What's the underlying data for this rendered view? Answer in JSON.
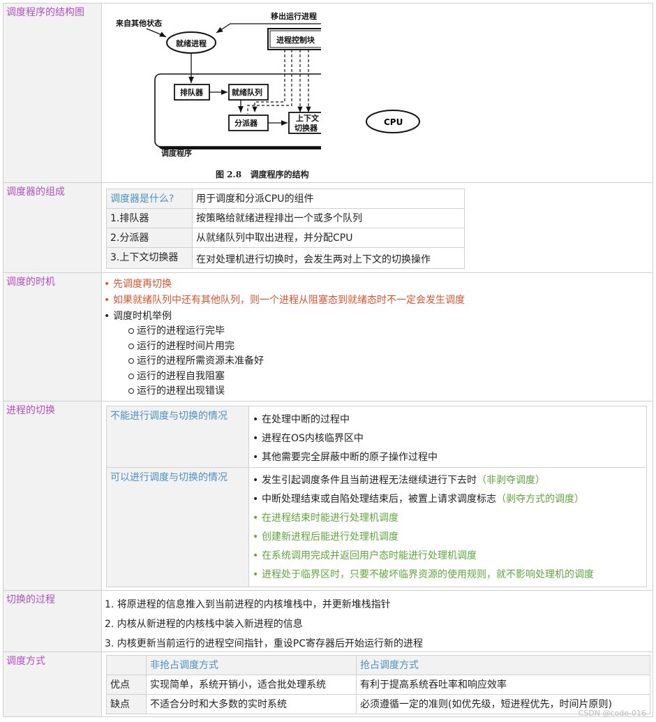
{
  "rows": {
    "r1": {
      "label": "调度程序的结构图"
    },
    "r2": {
      "label": "调度器的组成"
    },
    "r3": {
      "label": "调度的时机"
    },
    "r4": {
      "label": "进程的切换"
    },
    "r5": {
      "label": "切换的过程"
    },
    "r6": {
      "label": "调度方式"
    }
  },
  "diagram": {
    "from_other": "来自其他状态",
    "move_out": "移出运行进程",
    "ready_process": "就绪进程",
    "pcb": "进程控制块",
    "enqueuer": "排队器",
    "ready_queue": "就绪队列",
    "dispatcher": "分派器",
    "ctx1": "上下文",
    "ctx2": "切换器",
    "cpu": "CPU",
    "scheduler": "调度程序",
    "caption_num": "图 2.8",
    "caption_text": "调度程序的结构"
  },
  "composition": {
    "rows": [
      {
        "k": "调度器是什么?",
        "v": "用于调度和分派CPU的组件"
      },
      {
        "k": "1.排队器",
        "v": "按策略给就绪进程排出一个或多个队列"
      },
      {
        "k": "2.分派器",
        "v": "从就绪队列中取出进程，并分配CPU"
      },
      {
        "k": "3.上下文切换器",
        "v": "在对处理机进行切换时，会发生两对上下文的切换操作"
      }
    ]
  },
  "timing": {
    "b1": "先调度再切换",
    "b2": "如果就绪队列中还有其他队列，则一个进程从阻塞态到就绪态时不一定会发生调度",
    "b3": "调度时机举例",
    "examples": [
      "运行的进程运行完毕",
      "运行的进程时间片用完",
      "运行的进程所需资源未准备好",
      "运行的进程自我阻塞",
      "运行的进程出现错误"
    ]
  },
  "switching": {
    "cannot_label": "不能进行调度与切换的情况",
    "cannot": [
      "在处理中断的过程中",
      "进程在OS内核临界区中",
      "其他需要完全屏蔽中断的原子操作过程中"
    ],
    "can_label": "可以进行调度与切换的情况",
    "can1": "发生引起调度条件且当前进程无法继续进行下去时",
    "can1_note": "（非剥夺调度）",
    "can2": "中断处理结束或自陷处理结束后，被置上请求调度标志",
    "can2_note": "（剥夺方式的调度）",
    "can_green": [
      "在进程结束时能进行处理机调度",
      "创建新进程后能进行处理机调度",
      "在系统调用完成并返回用户态时能进行处理机调度",
      "进程处于临界区时，只要不破坏临界资源的使用规则，就不影响处理机的调度"
    ]
  },
  "process": {
    "steps": [
      "1. 将原进程的信息推入到当前进程的内核堆栈中，并更新堆栈指针",
      "2. 内核从新进程的内核栈中装入新进程的信息",
      "3. 内核更新当前运行的进程空间指针，重设PC寄存器后开始运行新的进程"
    ]
  },
  "modes": {
    "h1": "非抢占调度方式",
    "h2": "抢占调度方式",
    "pro_label": "优点",
    "pro1": "实现简单，系统开销小，适合批处理系统",
    "pro2": "有利于提高系统吞吐率和响应效率",
    "con_label": "缺点",
    "con1": "不适合分时和大多数的实时系统",
    "con2": "必须遵循一定的准则(如优先级，短进程优先，时间片原则)"
  },
  "watermark": "CSDN @code-016"
}
